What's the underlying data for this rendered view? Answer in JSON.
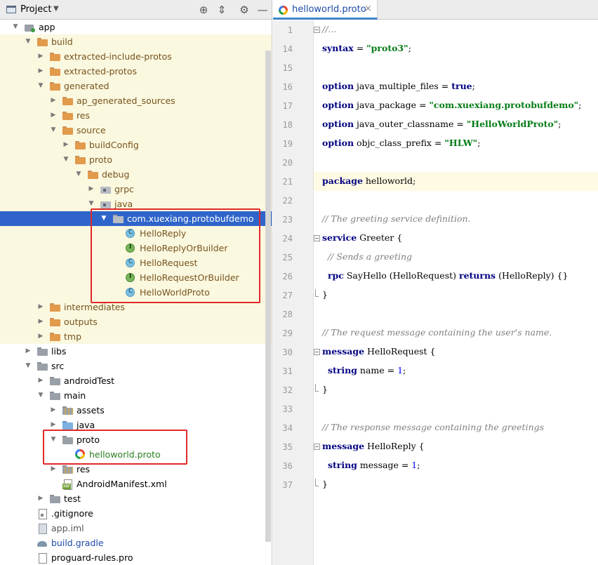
{
  "project_panel": {
    "title": "Project",
    "tools": [
      "locate-icon",
      "collapse-icon",
      "gear-icon",
      "hide-icon"
    ],
    "tree": [
      {
        "label": "app",
        "depth": 0,
        "arrow": "down",
        "icon": "module",
        "style": "plain",
        "gen": false
      },
      {
        "label": "build",
        "depth": 1,
        "arrow": "down",
        "icon": "folder",
        "style": "excluded",
        "gen": true
      },
      {
        "label": "extracted-include-protos",
        "depth": 2,
        "arrow": "right",
        "icon": "folder",
        "style": "excluded",
        "gen": true
      },
      {
        "label": "extracted-protos",
        "depth": 2,
        "arrow": "right",
        "icon": "folder",
        "style": "excluded",
        "gen": true
      },
      {
        "label": "generated",
        "depth": 2,
        "arrow": "down",
        "icon": "folder",
        "style": "excluded",
        "gen": true
      },
      {
        "label": "ap_generated_sources",
        "depth": 3,
        "arrow": "right",
        "icon": "folder",
        "style": "excluded",
        "gen": true
      },
      {
        "label": "res",
        "depth": 3,
        "arrow": "right",
        "icon": "folder",
        "style": "excluded",
        "gen": true
      },
      {
        "label": "source",
        "depth": 3,
        "arrow": "down",
        "icon": "folder",
        "style": "excluded",
        "gen": true
      },
      {
        "label": "buildConfig",
        "depth": 4,
        "arrow": "right",
        "icon": "folder",
        "style": "excluded",
        "gen": true
      },
      {
        "label": "proto",
        "depth": 4,
        "arrow": "down",
        "icon": "folder",
        "style": "excluded",
        "gen": true
      },
      {
        "label": "debug",
        "depth": 5,
        "arrow": "down",
        "icon": "folder",
        "style": "excluded",
        "gen": true
      },
      {
        "label": "grpc",
        "depth": 6,
        "arrow": "right",
        "icon": "pkg-dots",
        "style": "excluded",
        "gen": true
      },
      {
        "label": "java",
        "depth": 6,
        "arrow": "down",
        "icon": "pkg-dots",
        "style": "excluded",
        "gen": true
      },
      {
        "label": "com.xuexiang.protobufdemo",
        "depth": 7,
        "arrow": "down",
        "icon": "pkg",
        "style": "plain",
        "gen": false,
        "selected": true
      },
      {
        "label": "HelloReply",
        "depth": 8,
        "arrow": "",
        "icon": "class",
        "style": "excluded",
        "gen": true
      },
      {
        "label": "HelloReplyOrBuilder",
        "depth": 8,
        "arrow": "",
        "icon": "iface",
        "style": "excluded",
        "gen": true
      },
      {
        "label": "HelloRequest",
        "depth": 8,
        "arrow": "",
        "icon": "class",
        "style": "excluded",
        "gen": true
      },
      {
        "label": "HelloRequestOrBuilder",
        "depth": 8,
        "arrow": "",
        "icon": "iface",
        "style": "excluded",
        "gen": true
      },
      {
        "label": "HelloWorldProto",
        "depth": 8,
        "arrow": "",
        "icon": "class",
        "style": "excluded",
        "gen": true
      },
      {
        "label": "intermediates",
        "depth": 2,
        "arrow": "right",
        "icon": "folder",
        "style": "excluded",
        "gen": true
      },
      {
        "label": "outputs",
        "depth": 2,
        "arrow": "right",
        "icon": "folder",
        "style": "excluded",
        "gen": true
      },
      {
        "label": "tmp",
        "depth": 2,
        "arrow": "right",
        "icon": "folder",
        "style": "excluded",
        "gen": true
      },
      {
        "label": "libs",
        "depth": 1,
        "arrow": "right",
        "icon": "folder-gray",
        "style": "plain",
        "gen": false
      },
      {
        "label": "src",
        "depth": 1,
        "arrow": "down",
        "icon": "folder-gray",
        "style": "plain",
        "gen": false
      },
      {
        "label": "androidTest",
        "depth": 2,
        "arrow": "right",
        "icon": "folder-gray",
        "style": "plain",
        "gen": false
      },
      {
        "label": "main",
        "depth": 2,
        "arrow": "down",
        "icon": "folder-gray",
        "style": "plain",
        "gen": false
      },
      {
        "label": "assets",
        "depth": 3,
        "arrow": "right",
        "icon": "folder-res",
        "style": "plain",
        "gen": false
      },
      {
        "label": "java",
        "depth": 3,
        "arrow": "right",
        "icon": "folder-blue",
        "style": "plain",
        "gen": false
      },
      {
        "label": "proto",
        "depth": 3,
        "arrow": "down",
        "icon": "folder-gray",
        "style": "plain",
        "gen": false
      },
      {
        "label": "helloworld.proto",
        "depth": 4,
        "arrow": "",
        "icon": "proto",
        "style": "green",
        "gen": false
      },
      {
        "label": "res",
        "depth": 3,
        "arrow": "right",
        "icon": "folder-res",
        "style": "plain",
        "gen": false
      },
      {
        "label": "AndroidManifest.xml",
        "depth": 3,
        "arrow": "",
        "icon": "manifest",
        "style": "plain",
        "gen": false
      },
      {
        "label": "test",
        "depth": 2,
        "arrow": "right",
        "icon": "folder-gray",
        "style": "plain",
        "gen": false
      },
      {
        "label": ".gitignore",
        "depth": 1,
        "arrow": "",
        "icon": "git",
        "style": "plain",
        "gen": false
      },
      {
        "label": "app.iml",
        "depth": 1,
        "arrow": "",
        "icon": "iml",
        "style": "gray",
        "gen": false
      },
      {
        "label": "build.gradle",
        "depth": 1,
        "arrow": "",
        "icon": "gradle",
        "style": "blue",
        "gen": false
      },
      {
        "label": "proguard-rules.pro",
        "depth": 1,
        "arrow": "",
        "icon": "file",
        "style": "plain",
        "gen": false
      }
    ]
  },
  "editor": {
    "tab": {
      "label": "helloworld.proto",
      "close": "×"
    },
    "current_line": "21",
    "lines": [
      {
        "n": "1",
        "fold": "open",
        "parts": [
          [
            "cmt",
            "//..."
          ]
        ]
      },
      {
        "n": "14",
        "parts": [
          [
            "kw",
            "syntax"
          ],
          [
            "",
            " = "
          ],
          [
            "str",
            "\"proto3\""
          ],
          [
            "",
            ";"
          ]
        ]
      },
      {
        "n": "15",
        "parts": []
      },
      {
        "n": "16",
        "parts": [
          [
            "kw",
            "option"
          ],
          [
            "",
            " java_multiple_files = "
          ],
          [
            "kw",
            "true"
          ],
          [
            "",
            ";"
          ]
        ]
      },
      {
        "n": "17",
        "parts": [
          [
            "kw",
            "option"
          ],
          [
            "",
            " java_package = "
          ],
          [
            "str",
            "\"com.xuexiang.protobufdemo\""
          ],
          [
            "",
            ";"
          ]
        ]
      },
      {
        "n": "18",
        "parts": [
          [
            "kw",
            "option"
          ],
          [
            "",
            " java_outer_classname = "
          ],
          [
            "str",
            "\"HelloWorldProto\""
          ],
          [
            "",
            ";"
          ]
        ]
      },
      {
        "n": "19",
        "parts": [
          [
            "kw",
            "option"
          ],
          [
            "",
            " objc_class_prefix = "
          ],
          [
            "str",
            "\"HLW\""
          ],
          [
            "",
            ";"
          ]
        ]
      },
      {
        "n": "20",
        "parts": []
      },
      {
        "n": "21",
        "parts": [
          [
            "kw",
            "package"
          ],
          [
            "",
            " helloworld;"
          ]
        ]
      },
      {
        "n": "22",
        "parts": []
      },
      {
        "n": "23",
        "parts": [
          [
            "cmt",
            "// The greeting service definition."
          ]
        ]
      },
      {
        "n": "24",
        "fold": "open",
        "parts": [
          [
            "kw",
            "service"
          ],
          [
            "",
            " Greeter {"
          ]
        ]
      },
      {
        "n": "25",
        "parts": [
          [
            "cmt",
            "  // Sends a greeting"
          ]
        ]
      },
      {
        "n": "26",
        "parts": [
          [
            "",
            "  "
          ],
          [
            "kw",
            "rpc"
          ],
          [
            "",
            " SayHello (HelloRequest) "
          ],
          [
            "kw",
            "returns"
          ],
          [
            "",
            " (HelloReply) {}"
          ]
        ]
      },
      {
        "n": "27",
        "fold": "end",
        "parts": [
          [
            "",
            "}"
          ]
        ]
      },
      {
        "n": "28",
        "parts": []
      },
      {
        "n": "29",
        "parts": [
          [
            "cmt",
            "// The request message containing the user's name."
          ]
        ]
      },
      {
        "n": "30",
        "fold": "open",
        "parts": [
          [
            "kw",
            "message"
          ],
          [
            "",
            " HelloRequest {"
          ]
        ]
      },
      {
        "n": "31",
        "parts": [
          [
            "",
            "  "
          ],
          [
            "kw",
            "string"
          ],
          [
            "",
            " name = "
          ],
          [
            "num",
            "1"
          ],
          [
            "",
            ";"
          ]
        ]
      },
      {
        "n": "32",
        "fold": "end",
        "parts": [
          [
            "",
            "}"
          ]
        ]
      },
      {
        "n": "33",
        "parts": []
      },
      {
        "n": "34",
        "parts": [
          [
            "cmt",
            "// The response message containing the greetings"
          ]
        ]
      },
      {
        "n": "35",
        "fold": "open",
        "parts": [
          [
            "kw",
            "message"
          ],
          [
            "",
            " HelloReply {"
          ]
        ]
      },
      {
        "n": "36",
        "parts": [
          [
            "",
            "  "
          ],
          [
            "kw",
            "string"
          ],
          [
            "",
            " message = "
          ],
          [
            "num",
            "1"
          ],
          [
            "",
            ";"
          ]
        ]
      },
      {
        "n": "37",
        "fold": "end",
        "parts": [
          [
            "",
            "}"
          ]
        ]
      }
    ]
  },
  "colors": {
    "selection": "#2f65ca",
    "generated_bg": "#fbf8e0",
    "excluded_text": "#76541d",
    "annotation_box": "#e12a2a",
    "tab_underline": "#4083c9"
  }
}
